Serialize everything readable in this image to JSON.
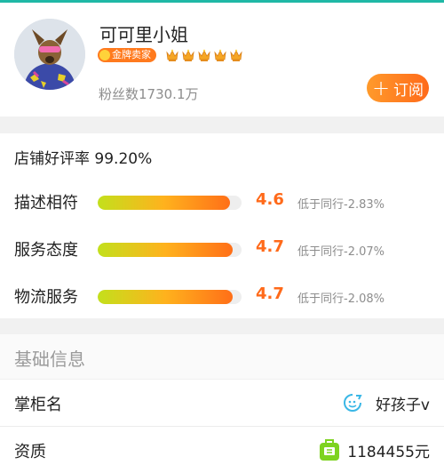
{
  "header": {
    "shop_name": "可可里小姐",
    "badge_label": "金牌卖家",
    "crown_count": 5,
    "fans": "粉丝数1730.1万",
    "subscribe_label": "订阅",
    "subscribe_icon": "+"
  },
  "ratings": {
    "good_rate": "店铺好评率 99.20%",
    "rows": [
      {
        "label": "描述相符",
        "score": "4.6",
        "compare": "低于同行-2.83%",
        "level": 0.92
      },
      {
        "label": "服务态度",
        "score": "4.7",
        "compare": "低于同行-2.07%",
        "level": 0.94
      },
      {
        "label": "物流服务",
        "score": "4.7",
        "compare": "低于同行-2.08%",
        "level": 0.94
      }
    ]
  },
  "basic": {
    "title": "基础信息",
    "owner_label": "掌柜名",
    "owner_value": "好孩子v",
    "cert_label": "资质",
    "cert_value": "1184455元"
  },
  "colors": {
    "accent": "#ff6a1a",
    "teal": "#1fb8a6",
    "badge": "#ff7a1e"
  }
}
